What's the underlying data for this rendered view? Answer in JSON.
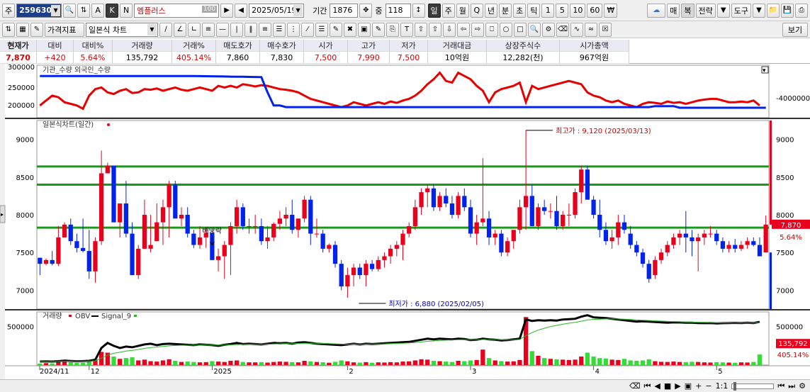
{
  "toolbar1": {
    "market_label": "주",
    "code": "259630",
    "name": "엠플러스",
    "name_badge": "100",
    "date": "2025/05/19",
    "period_label": "기간",
    "period_value": "1876",
    "count_label": "중",
    "count_value": "118",
    "letters": [
      "A",
      "K",
      "N"
    ],
    "intervals": [
      "일",
      "주",
      "월",
      "Q",
      "년",
      "분",
      "초",
      "틱",
      "1",
      "5",
      "10",
      "60",
      "₩"
    ],
    "right_buttons": [
      "매",
      "복",
      "전략",
      "도구"
    ]
  },
  "toolbar2": {
    "indicator_dropdown": "가격지표",
    "chart_type_dropdown": "일본식 차트",
    "view_button": "보기"
  },
  "quote": {
    "headers": [
      "현재가",
      "대비",
      "대비%",
      "거래량",
      "거래%",
      "매도호가",
      "매수호가",
      "시가",
      "고가",
      "저가",
      "거래대금",
      "상장주식수",
      "시가총액"
    ],
    "values": [
      "7,870",
      "+420",
      "5.64%",
      "135,792",
      "405.14%",
      "7,860",
      "7,830",
      "7,500",
      "7,990",
      "7,500",
      "10억원",
      "12,282(천)",
      "967억원"
    ]
  },
  "panels": {
    "top_label": "기관_수량   외국인_수량",
    "top_left_ticks": [
      "300000",
      "250000",
      "200000"
    ],
    "top_right_ticks": [
      "-4000000"
    ],
    "price_label": "일본식차트(일간)",
    "price_ticks": [
      "9000",
      "8500",
      "8000",
      "7500",
      "7000"
    ],
    "current_price_tag": "7,870",
    "current_pct_tag": "5.64%",
    "high_annotation": "최고가 : 9,120 (2025/03/13)",
    "low_annotation": "최저가 : 6,880 (2025/02/05)",
    "dividend_marker": "배당락",
    "volume_legend": [
      "거래량",
      "OBV",
      "Signal_9"
    ],
    "volume_ticks": [
      "500000"
    ],
    "volume_tag": "135,792",
    "volume_pct_tag": "405.14%",
    "x_labels": [
      "2024/11",
      "12",
      "2025",
      "2",
      "3",
      "4",
      "5"
    ]
  },
  "colors": {
    "up": "#e8001c",
    "down": "#0022ee",
    "support_line": "#1a9a1a",
    "obv": "#000000",
    "signal": "#22bb22",
    "inst": "#e80000",
    "foreign": "#0022ee"
  },
  "statusbar": {
    "zoom": "1:1"
  },
  "chart_data": {
    "type": "candlestick",
    "series_count": 118,
    "price_range": [
      6750,
      9250
    ],
    "high": {
      "value": 9120,
      "date": "2025/03/13"
    },
    "low": {
      "value": 6880,
      "date": "2025/02/05"
    },
    "support_lines": [
      8640,
      8400,
      7830
    ],
    "candles": [
      [
        7430,
        7420,
        7200,
        7350
      ],
      [
        7350,
        7420,
        7330,
        7400
      ],
      [
        7400,
        7520,
        7330,
        7350
      ],
      [
        7350,
        7850,
        7320,
        7700
      ],
      [
        7700,
        7900,
        7700,
        7870
      ],
      [
        7870,
        7950,
        7600,
        7650
      ],
      [
        7650,
        7750,
        7500,
        7560
      ],
      [
        7560,
        7950,
        7500,
        7520
      ],
      [
        7520,
        7800,
        7150,
        7250
      ],
      [
        7250,
        7700,
        7100,
        7650
      ],
      [
        7650,
        8850,
        7600,
        8550
      ],
      [
        8550,
        8690,
        8550,
        8650
      ],
      [
        8650,
        8600,
        7900,
        7900
      ],
      [
        7900,
        8000,
        7700,
        8150
      ],
      [
        8150,
        8450,
        7700,
        7750
      ],
      [
        7750,
        7900,
        7200,
        7200
      ],
      [
        7200,
        7600,
        7150,
        7550
      ],
      [
        7550,
        8200,
        7550,
        8000
      ],
      [
        7550,
        8000,
        7500,
        7600
      ],
      [
        7650,
        8150,
        7650,
        7900
      ],
      [
        7900,
        8200,
        7600,
        8100
      ],
      [
        8100,
        8450,
        7700,
        8400
      ],
      [
        8400,
        8450,
        8000,
        7950
      ],
      [
        7950,
        8100,
        7850,
        8000
      ],
      [
        8000,
        8100,
        7700,
        7750
      ],
      [
        7750,
        7800,
        7560,
        7600
      ],
      [
        7600,
        7850,
        7550,
        7700
      ],
      [
        7700,
        7830,
        7560,
        7760
      ],
      [
        7760,
        7830,
        7620,
        7400
      ],
      [
        7400,
        7550,
        7250,
        7450
      ],
      [
        7450,
        7650,
        7150,
        7600
      ],
      [
        7600,
        7900,
        7200,
        7850
      ],
      [
        7850,
        8200,
        7750,
        8100
      ],
      [
        8100,
        8150,
        7800,
        7850
      ],
      [
        7850,
        7950,
        7750,
        7850
      ],
      [
        7850,
        8000,
        7750,
        7850
      ],
      [
        7850,
        7950,
        7600,
        7650
      ],
      [
        7650,
        7850,
        7550,
        7700
      ],
      [
        7700,
        7900,
        7650,
        7880
      ],
      [
        7880,
        8050,
        7800,
        7950
      ],
      [
        7950,
        8100,
        7850,
        8000
      ],
      [
        8000,
        8200,
        7750,
        7800
      ],
      [
        7800,
        7950,
        7700,
        7950
      ],
      [
        7950,
        8250,
        7900,
        8200
      ],
      [
        8200,
        8250,
        7600,
        7750
      ],
      [
        7750,
        7950,
        7700,
        7750
      ],
      [
        7750,
        7800,
        7500,
        7550
      ],
      [
        7550,
        7620,
        7500,
        7600
      ],
      [
        7600,
        7650,
        7300,
        7350
      ],
      [
        7350,
        7400,
        7000,
        7050
      ],
      [
        7050,
        7300,
        6900,
        7200
      ],
      [
        7200,
        7350,
        7050,
        7300
      ],
      [
        7300,
        7350,
        7150,
        7200
      ],
      [
        7200,
        7400,
        7050,
        7350
      ],
      [
        7350,
        7400,
        7250,
        7280
      ],
      [
        7280,
        7450,
        7250,
        7400
      ],
      [
        7400,
        7500,
        7300,
        7450
      ],
      [
        7450,
        7600,
        7350,
        7550
      ],
      [
        7550,
        7650,
        7450,
        7600
      ],
      [
        7600,
        7800,
        7400,
        7750
      ],
      [
        7750,
        7900,
        7700,
        7850
      ],
      [
        7850,
        8200,
        7800,
        8100
      ],
      [
        8100,
        8350,
        8000,
        8300
      ],
      [
        8300,
        8400,
        8100,
        8350
      ],
      [
        8350,
        8400,
        8050,
        8100
      ],
      [
        8100,
        8300,
        8050,
        8250
      ],
      [
        8250,
        8350,
        8100,
        8150
      ],
      [
        8150,
        8250,
        7950,
        8000
      ],
      [
        8000,
        8300,
        7950,
        8250
      ],
      [
        8250,
        8350,
        8050,
        8100
      ],
      [
        8100,
        8200,
        7700,
        7750
      ],
      [
        7750,
        8000,
        7600,
        7900
      ],
      [
        7900,
        8750,
        7850,
        7950
      ],
      [
        7950,
        8050,
        7600,
        7700
      ],
      [
        7700,
        7800,
        7600,
        7750
      ],
      [
        7750,
        7800,
        7450,
        7500
      ],
      [
        7500,
        7700,
        7450,
        7650
      ],
      [
        7650,
        7800,
        7550,
        7800
      ],
      [
        7800,
        8200,
        7750,
        8100
      ],
      [
        8100,
        9120,
        7800,
        8250
      ],
      [
        8250,
        8400,
        7850,
        7850
      ],
      [
        7850,
        8150,
        7800,
        8100
      ],
      [
        8100,
        8200,
        8000,
        8050
      ],
      [
        8050,
        8150,
        7950,
        8050
      ],
      [
        8050,
        8250,
        7800,
        7850
      ],
      [
        7850,
        8050,
        7800,
        8000
      ],
      [
        8000,
        8150,
        7850,
        8000
      ],
      [
        8000,
        8350,
        7950,
        8300
      ],
      [
        8300,
        8650,
        8150,
        8600
      ],
      [
        8600,
        8650,
        8200,
        8200
      ],
      [
        8200,
        8250,
        7950,
        8000
      ],
      [
        8000,
        8200,
        7700,
        7800
      ],
      [
        7800,
        7900,
        7600,
        7650
      ],
      [
        7650,
        7800,
        7550,
        7700
      ],
      [
        7700,
        8000,
        7600,
        7900
      ],
      [
        7900,
        8000,
        7750,
        7800
      ],
      [
        7750,
        7850,
        7550,
        7600
      ],
      [
        7600,
        7650,
        7450,
        7500
      ],
      [
        7500,
        7550,
        7300,
        7350
      ],
      [
        7350,
        7400,
        7100,
        7150
      ],
      [
        7200,
        7450,
        7150,
        7400
      ],
      [
        7400,
        7550,
        7350,
        7500
      ],
      [
        7500,
        7650,
        7450,
        7600
      ],
      [
        7600,
        7750,
        7550,
        7700
      ],
      [
        7700,
        7800,
        7600,
        7750
      ],
      [
        7750,
        8050,
        7500,
        7700
      ],
      [
        7700,
        7800,
        7450,
        7650
      ],
      [
        7650,
        7750,
        7250,
        7700
      ],
      [
        7700,
        7800,
        7600,
        7750
      ],
      [
        7750,
        7850,
        7700,
        7750
      ],
      [
        7750,
        7800,
        7600,
        7650
      ],
      [
        7650,
        7700,
        7500,
        7550
      ],
      [
        7550,
        7650,
        7500,
        7600
      ],
      [
        7600,
        7680,
        7500,
        7550
      ],
      [
        7550,
        7650,
        7520,
        7600
      ],
      [
        7600,
        7700,
        7550,
        7650
      ],
      [
        7650,
        7700,
        7580,
        7600
      ],
      [
        7600,
        7700,
        7500,
        7450
      ],
      [
        7500,
        7990,
        7500,
        7870
      ]
    ],
    "volume_max": 650000,
    "volumes": [
      20000,
      25000,
      22000,
      40000,
      60000,
      35000,
      28000,
      30000,
      45000,
      70000,
      170000,
      160000,
      110000,
      80000,
      90000,
      100000,
      60000,
      70000,
      50000,
      45000,
      60000,
      75000,
      55000,
      40000,
      45000,
      40000,
      35000,
      38000,
      50000,
      45000,
      40000,
      55000,
      60000,
      40000,
      35000,
      35000,
      38000,
      32000,
      40000,
      45000,
      42000,
      38000,
      35000,
      55000,
      48000,
      40000,
      36000,
      30000,
      42000,
      60000,
      48000,
      35000,
      32000,
      38000,
      30000,
      35000,
      33000,
      38000,
      35000,
      45000,
      48000,
      60000,
      75000,
      70000,
      55000,
      50000,
      45000,
      40000,
      55000,
      50000,
      60000,
      65000,
      200000,
      90000,
      60000,
      50000,
      45000,
      48000,
      65000,
      620000,
      180000,
      120000,
      90000,
      80000,
      75000,
      70000,
      65000,
      70000,
      110000,
      160000,
      110000,
      90000,
      85000,
      70000,
      65000,
      80000,
      60000,
      55000,
      60000,
      75000,
      50000,
      42000,
      40000,
      45000,
      40000,
      38000,
      42000,
      40000,
      35000,
      33000,
      38000,
      35000,
      32000,
      30000,
      35000,
      33000,
      40000,
      135792
    ],
    "obv": [
      50000,
      52000,
      50000,
      55000,
      62000,
      58000,
      54000,
      56000,
      60000,
      75000,
      240000,
      310000,
      270000,
      240000,
      260000,
      250000,
      270000,
      290000,
      300000,
      280000,
      295000,
      300000,
      295000,
      290000,
      285000,
      280000,
      290000,
      285000,
      280000,
      270000,
      285000,
      295000,
      310000,
      295000,
      300000,
      295000,
      290000,
      300000,
      310000,
      305000,
      310000,
      300000,
      315000,
      320000,
      310000,
      300000,
      295000,
      290000,
      285000,
      280000,
      290000,
      300000,
      290000,
      300000,
      295000,
      300000,
      305000,
      310000,
      315000,
      320000,
      325000,
      340000,
      355000,
      370000,
      360000,
      370000,
      365000,
      360000,
      370000,
      365000,
      350000,
      355000,
      370000,
      360000,
      355000,
      345000,
      350000,
      360000,
      370000,
      640000,
      620000,
      630000,
      625000,
      630000,
      625000,
      640000,
      645000,
      650000,
      680000,
      700000,
      670000,
      665000,
      660000,
      650000,
      640000,
      630000,
      620000,
      610000,
      615000,
      610000,
      605000,
      600000,
      595000,
      600000,
      598000,
      595000,
      595000,
      590000,
      588000,
      590000,
      585000,
      588000,
      590000,
      592000,
      590000,
      595000,
      590000,
      605000
    ]
  }
}
